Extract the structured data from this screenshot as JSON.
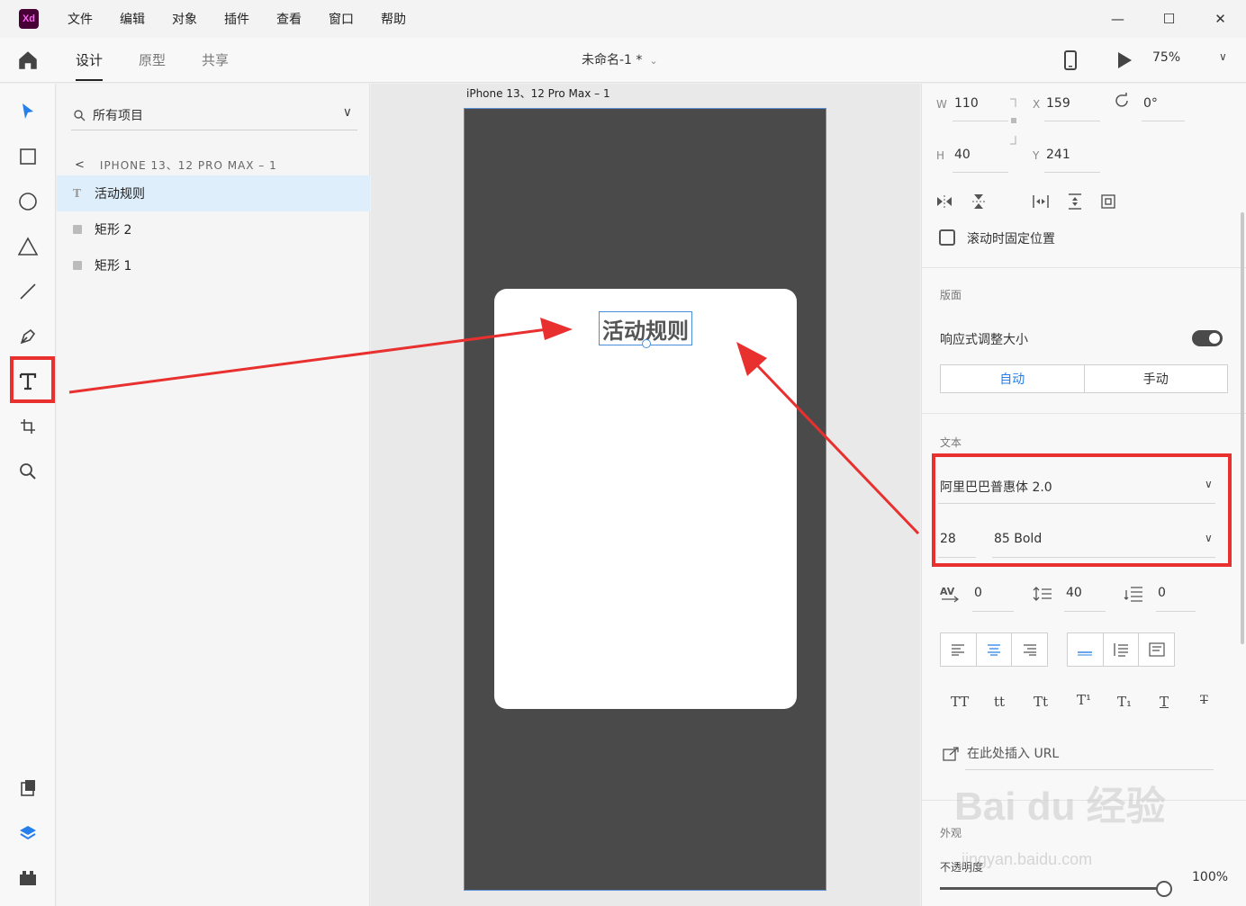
{
  "app": {
    "logo": "Xd"
  },
  "menu": [
    "文件",
    "编辑",
    "对象",
    "插件",
    "查看",
    "窗口",
    "帮助"
  ],
  "window_controls": {
    "minimize": "—",
    "maximize": "☐",
    "close": "✕"
  },
  "mode_tabs": [
    "设计",
    "原型",
    "共享"
  ],
  "document": {
    "name": "未命名-1 *"
  },
  "toolbar": {
    "zoom": "75%"
  },
  "layers": {
    "search_label": "所有项目",
    "breadcrumb": "IPHONE 13、12 PRO MAX – 1",
    "items": [
      {
        "label": "活动规则",
        "kind": "text",
        "selected": true
      },
      {
        "label": "矩形 2",
        "kind": "rect",
        "selected": false
      },
      {
        "label": "矩形 1",
        "kind": "rect",
        "selected": false
      }
    ]
  },
  "canvas": {
    "artboard_label": "iPhone 13、12 Pro Max – 1",
    "selected_text": "活动规则"
  },
  "props": {
    "w_label": "W",
    "w_value": "110",
    "x_label": "X",
    "x_value": "159",
    "rotation": "0°",
    "h_label": "H",
    "h_value": "40",
    "y_label": "Y",
    "y_value": "241",
    "fix_scroll": "滚动时固定位置",
    "layout_title": "版面",
    "responsive": "响应式调整大小",
    "resize_auto": "自动",
    "resize_manual": "手动",
    "text_title": "文本",
    "font_family": "阿里巴巴普惠体 2.0",
    "font_size": "28",
    "font_weight": "85 Bold",
    "char_spacing": "0",
    "line_spacing": "40",
    "para_spacing": "0",
    "type_buttons": [
      "TT",
      "tt",
      "Tt",
      "T¹",
      "T₁",
      "T",
      "T"
    ],
    "url_placeholder": "在此处插入 URL",
    "appearance_title": "外观",
    "opacity_label": "不透明度",
    "opacity_value": "100%"
  },
  "colors": {
    "accent": "#2680eb",
    "highlight": "#e8302f",
    "artboard": "#4a4a4a"
  }
}
